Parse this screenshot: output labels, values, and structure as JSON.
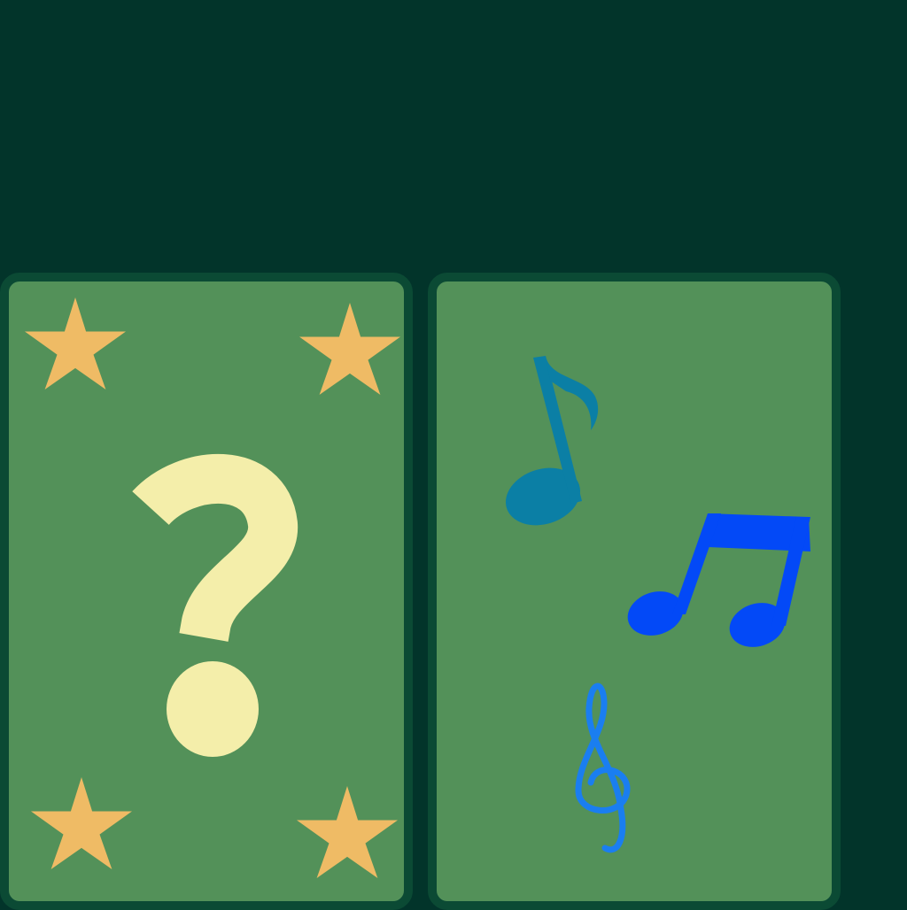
{
  "game": {
    "cards": [
      {
        "state": "face-down",
        "symbol": "question-mark",
        "corner_icons": [
          "star",
          "star",
          "star",
          "star"
        ]
      },
      {
        "state": "face-up",
        "symbols": [
          "eighth-note",
          "beamed-eighth-notes",
          "treble-clef"
        ]
      }
    ]
  },
  "colors": {
    "background": "#02342a",
    "card_border": "#0b4a34",
    "card_fill": "#539159",
    "star": "#efbb65",
    "question_mark": "#f4eeaa",
    "eighth_note": "#0b7fa5",
    "beamed_notes": "#0349f7",
    "treble_clef": "#1a7ef0"
  }
}
